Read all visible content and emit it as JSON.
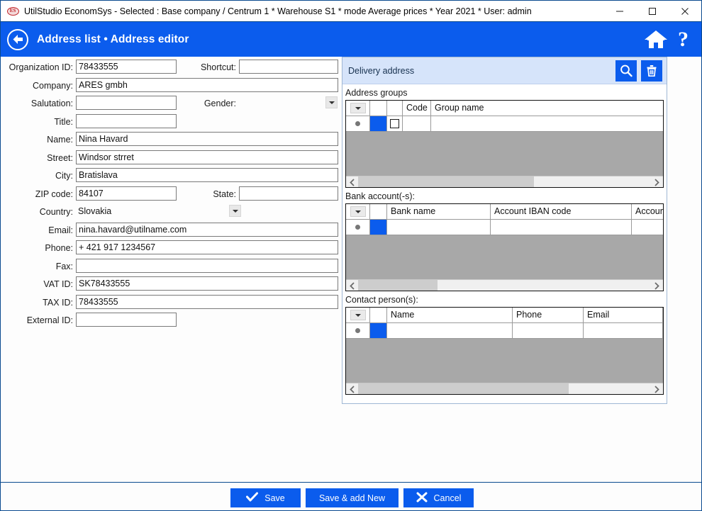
{
  "window": {
    "app_icon": "es-logo-icon",
    "title": "UtilStudio EconomSys - Selected : Base company / Centrum 1 * Warehouse S1 * mode Average prices * Year 2021 * User: admin",
    "controls": {
      "minimize": "minimize-icon",
      "maximize": "maximize-icon",
      "close": "close-icon"
    }
  },
  "header": {
    "back_icon": "back-arrow-icon",
    "title": "Address list • Address editor",
    "home_icon": "home-icon",
    "help_label": "?"
  },
  "form": {
    "fields": [
      {
        "label": "Organization ID:",
        "value": "78433555",
        "placeholder": ""
      },
      {
        "label": "Shortcut:",
        "value": "",
        "placeholder": ""
      },
      {
        "label": "Company:",
        "value": "ARES gmbh",
        "placeholder": ""
      },
      {
        "label": "Salutation:",
        "value": "",
        "placeholder": ""
      },
      {
        "label": "Gender:",
        "value": "",
        "placeholder": ""
      },
      {
        "label": "Title:",
        "value": "",
        "placeholder": ""
      },
      {
        "label": "Name:",
        "value": "Nina Havard",
        "placeholder": ""
      },
      {
        "label": "Street:",
        "value": "Windsor strret",
        "placeholder": ""
      },
      {
        "label": "City:",
        "value": "Bratislava",
        "placeholder": ""
      },
      {
        "label": "ZIP code:",
        "value": "84107",
        "placeholder": ""
      },
      {
        "label": "State:",
        "value": "",
        "placeholder": ""
      },
      {
        "label": "Country:",
        "value": "Slovakia",
        "placeholder": ""
      },
      {
        "label": "Email:",
        "value": "nina.havard@utilname.com",
        "placeholder": ""
      },
      {
        "label": "Phone:",
        "value": "+ 421 917 1234567",
        "placeholder": ""
      },
      {
        "label": "Fax:",
        "value": "",
        "placeholder": ""
      },
      {
        "label": "VAT ID:",
        "value": "SK78433555",
        "placeholder": ""
      },
      {
        "label": "TAX ID:",
        "value": "78433555",
        "placeholder": ""
      },
      {
        "label": "External ID:",
        "value": "",
        "placeholder": ""
      }
    ]
  },
  "delivery": {
    "label": "Delivery address",
    "search_icon": "search-icon",
    "delete_icon": "trash-icon"
  },
  "grids": {
    "address_groups": {
      "caption": "Address groups",
      "menu_icon": "chevron-down-icon",
      "columns": [
        "Code",
        "Group name"
      ],
      "rows": [
        {
          "Code": "",
          "Group name": ""
        }
      ],
      "scroll_thumb_pct": 60
    },
    "bank_accounts": {
      "caption": "Bank account(-s):",
      "menu_icon": "chevron-down-icon",
      "columns": [
        "Bank name",
        "Account IBAN code",
        "Account"
      ],
      "rows": [
        {
          "Bank name": "",
          "Account IBAN code": "",
          "Account": ""
        }
      ],
      "scroll_thumb_pct": 27
    },
    "contact_persons": {
      "caption": "Contact person(s):",
      "menu_icon": "chevron-down-icon",
      "columns": [
        "Name",
        "Phone",
        "Email"
      ],
      "rows": [
        {
          "Name": "",
          "Phone": "",
          "Email": ""
        }
      ],
      "scroll_thumb_pct": 72
    }
  },
  "footer": {
    "save": {
      "label": "Save",
      "icon": "check-icon"
    },
    "save_add_new": {
      "label": "Save & add New",
      "icon": ""
    },
    "cancel": {
      "label": "Cancel",
      "icon": "x-icon"
    }
  },
  "colors": {
    "accent": "#0b5ced",
    "title_border": "#0a4a8f",
    "delivery_bg": "#d6e4fa",
    "grid_filler": "#a8a8a8"
  }
}
